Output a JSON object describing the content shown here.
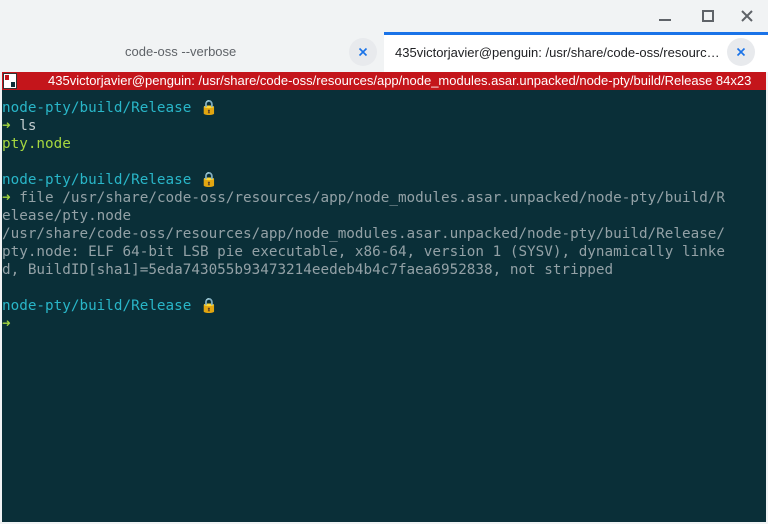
{
  "window": {
    "minimize_icon": "minimize-icon",
    "maximize_icon": "maximize-icon",
    "close_icon": "close-icon"
  },
  "tabs": [
    {
      "label": "code-oss --verbose",
      "active": false
    },
    {
      "label": "435victorjavier@penguin: /usr/share/code-oss/resources/app/node_modules.asar.unpacked/node-pty/build/Release",
      "active": true
    }
  ],
  "terminal": {
    "title": "435victorjavier@penguin: /usr/share/code-oss/resources/app/node_modules.asar.unpacked/node-pty/build/Release 84x23",
    "titlebar_color": "#c4151b",
    "background": "#0a2f38",
    "prompt_path": "node-pty/build/Release",
    "prompt_lock": "🔒",
    "prompt_arrow": "➜",
    "blocks": [
      {
        "command": "ls",
        "output": [
          "pty.node"
        ]
      },
      {
        "command": "file /usr/share/code-oss/resources/app/node_modules.asar.unpacked/node-pty/build/R",
        "command_wrap": "elease/pty.node",
        "output": [
          "/usr/share/code-oss/resources/app/node_modules.asar.unpacked/node-pty/build/Release/",
          "pty.node: ELF 64-bit LSB pie executable, x86-64, version 1 (SYSV), dynamically linke",
          "d, BuildID[sha1]=5eda743055b93473214eedeb4b4c7faea6952838, not stripped"
        ]
      }
    ]
  }
}
